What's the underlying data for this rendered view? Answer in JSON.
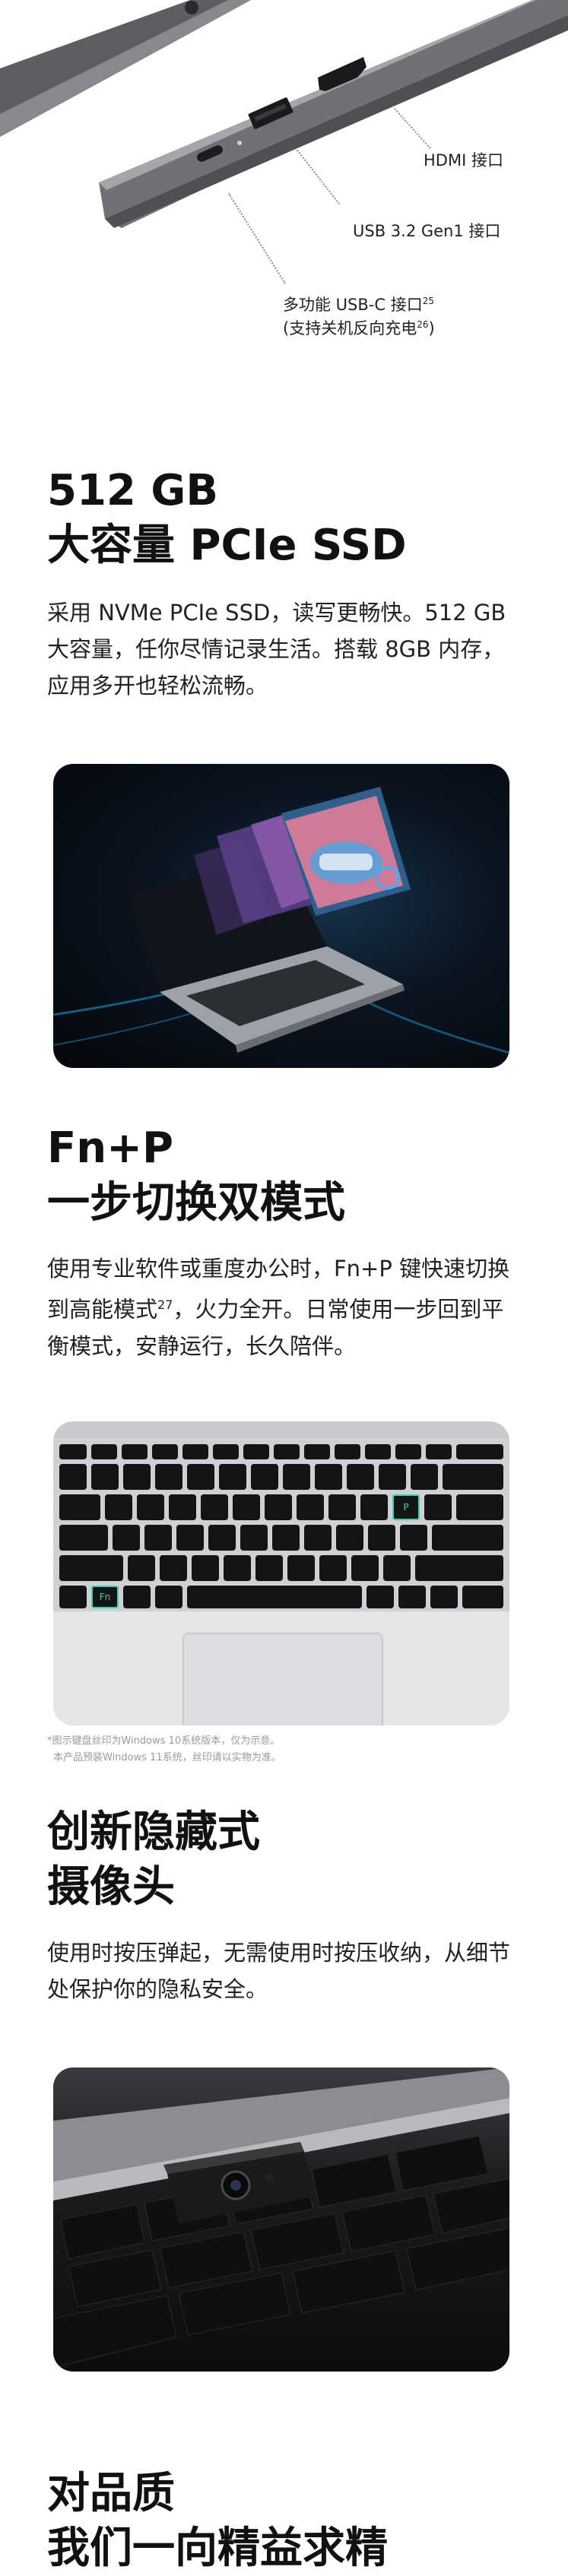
{
  "ports": {
    "hdmi": "HDMI 接口",
    "usb": "USB 3.2 Gen1 接口",
    "usbc_line1": "多功能 USB-C 接口",
    "usbc_sup1": "25",
    "usbc_line2": "(支持关机反向充电",
    "usbc_sup2": "26",
    "usbc_line2_end": ")"
  },
  "ssd": {
    "title_line1": "512 GB",
    "title_line2": "大容量 PCIe SSD",
    "body": "采用 NVMe PCIe SSD，读写更畅快。512 GB 大容量，任你尽情记录生活。搭载 8GB 内存，应用多开也轻松流畅。"
  },
  "fnp": {
    "title_line1": "Fn+P",
    "title_line2": "一步切换双模式",
    "body_part1": "使用专业软件或重度办公时，Fn+P 键快速切换到高能模式",
    "body_sup": "27",
    "body_part2": "，火力全开。日常使用一步回到平衡模式，安静运行，长久陪伴。",
    "note_line1": "*图示键盘丝印为Windows 10系统版本，仅为示意。",
    "note_line2": "本产品预装Windows 11系统，丝印请以实物为准。",
    "key_fn": "Fn",
    "key_p": "P"
  },
  "camera": {
    "title_line1": "创新隐藏式",
    "title_line2": "摄像头",
    "body": "使用时按压弹起，无需使用时按压收纳，从细节处保护你的隐私安全。"
  },
  "quality": {
    "title_line1": "对品质",
    "title_line2": "我们一向精益求精"
  },
  "colors": {
    "highlight": "#3bd3b4",
    "laptop_body": "#6e6e72",
    "card_dark": "#0a0e16"
  }
}
